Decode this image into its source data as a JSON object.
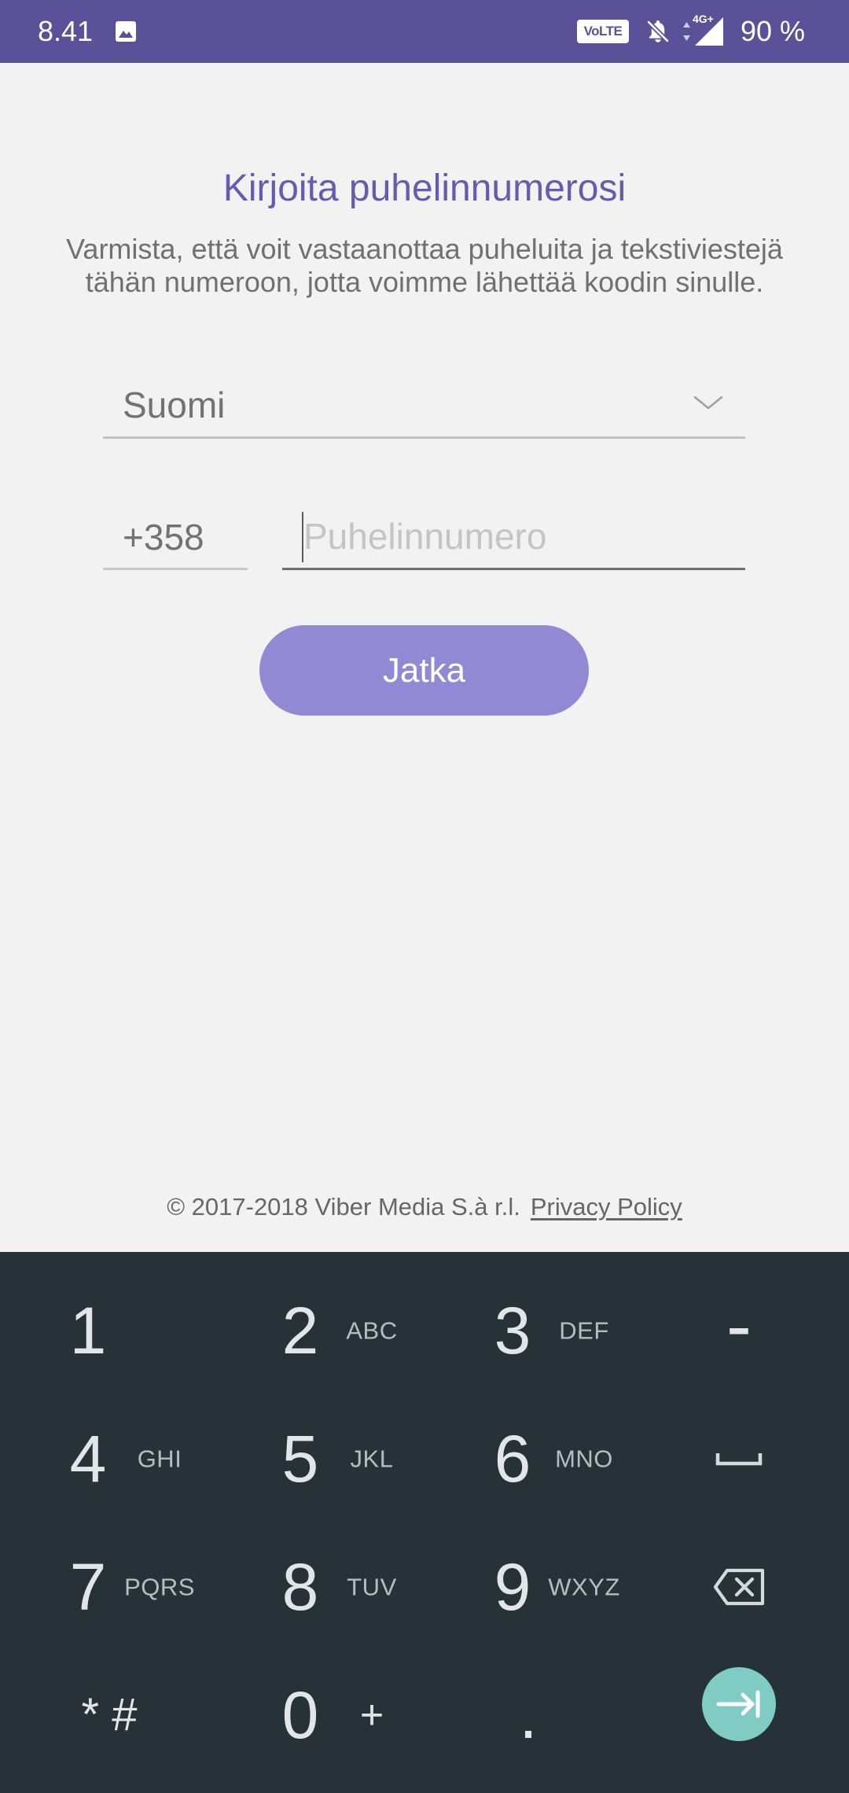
{
  "status_bar": {
    "time": "8.41",
    "notification_icon": "image-icon",
    "volte": "VoLTE",
    "ringer_icon": "bell-off-icon",
    "data_icon": "data-arrows-icon",
    "network_type": "4G+",
    "signal_icon": "signal-icon",
    "battery": "90 %"
  },
  "header": {
    "title": "Kirjoita puhelinnumerosi",
    "subtitle_lines": [
      "Varmista, että voit vastaanottaa puheluita ja tekstiviestejä",
      "tähän numeroon, jotta voimme lähettää koodin sinulle."
    ]
  },
  "form": {
    "country": "Suomi",
    "country_icon": "chevron-down-icon",
    "country_code": "+358",
    "phone_number": "",
    "phone_placeholder": "Puhelinnumero",
    "continue_label": "Jatka"
  },
  "footer": {
    "copyright": "© 2017-2018 Viber Media S.à r.l.",
    "privacy_link": "Privacy Policy"
  },
  "keypad": {
    "rows": [
      [
        {
          "label": "1"
        },
        {
          "label": "2",
          "sub": "ABC"
        },
        {
          "label": "3",
          "sub": "DEF"
        },
        {
          "label": "-"
        }
      ],
      [
        {
          "label": "4",
          "sub": "GHI"
        },
        {
          "label": "5",
          "sub": "JKL"
        },
        {
          "label": "6",
          "sub": "MNO"
        },
        {
          "icon": "space-icon"
        }
      ],
      [
        {
          "label": "7",
          "sub": "PQRS"
        },
        {
          "label": "8",
          "sub": "TUV"
        },
        {
          "label": "9",
          "sub": "WXYZ"
        },
        {
          "icon": "backspace-icon"
        }
      ],
      [
        {
          "label": "* #"
        },
        {
          "label": "0",
          "sub": "+"
        },
        {
          "label": "."
        },
        {
          "icon": "next-icon"
        }
      ]
    ]
  },
  "colors": {
    "status_bar": "#5a5199",
    "accent": "#665cad",
    "button": "#9289d4",
    "keyboard": "#263238",
    "next_key": "#80cbc4"
  }
}
